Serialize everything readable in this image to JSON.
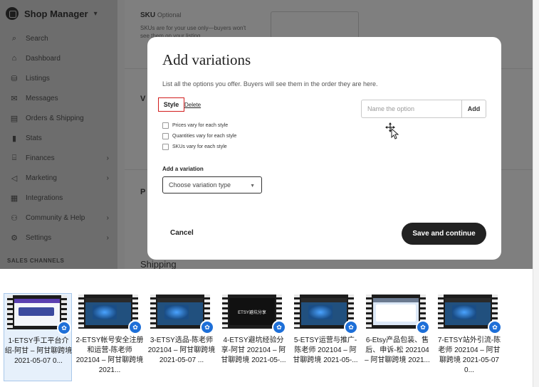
{
  "shop_manager": {
    "brand": "Shop Manager",
    "nav": [
      {
        "label": "Search",
        "icon": "search-icon"
      },
      {
        "label": "Dashboard",
        "icon": "home-icon"
      },
      {
        "label": "Listings",
        "icon": "listings-icon"
      },
      {
        "label": "Messages",
        "icon": "mail-icon"
      },
      {
        "label": "Orders & Shipping",
        "icon": "clipboard-icon"
      },
      {
        "label": "Stats",
        "icon": "bar-chart-icon"
      },
      {
        "label": "Finances",
        "icon": "bank-icon"
      },
      {
        "label": "Marketing",
        "icon": "megaphone-icon"
      },
      {
        "label": "Integrations",
        "icon": "grid-icon"
      },
      {
        "label": "Community & Help",
        "icon": "people-icon"
      },
      {
        "label": "Settings",
        "icon": "gear-icon"
      }
    ],
    "sales_channels": "SALES CHANNELS"
  },
  "background": {
    "sku_title": "SKU",
    "sku_optional": "Optional",
    "sku_desc": "SKUs are for your use only—buyers won't see them on your listing.",
    "shipping": "Shipping"
  },
  "modal": {
    "title": "Add variations",
    "subtitle": "List all the options you offer. Buyers will see them in the order they are here.",
    "style_tag": "Style",
    "delete_link": "Delete",
    "checkboxes": [
      "Prices vary for each style",
      "Quantities vary for each style",
      "SKUs vary for each style"
    ],
    "option_placeholder": "Name the option",
    "add_label": "Add",
    "add_variation_label": "Add a variation",
    "variation_select": "Choose variation type",
    "cancel_label": "Cancel",
    "save_label": "Save and continue"
  },
  "gallery": [
    {
      "caption": "1-ETSY手工平台介绍-阿甘 – 阿甘聊跨境 2021-05-07 0...",
      "style": "white"
    },
    {
      "caption": "2-ETSY帐号安全注册和运营-陈老师 202104 – 阿甘聊跨境 2021...",
      "style": "blue"
    },
    {
      "caption": "3-ETSY选品-陈老师 202104 – 阿甘聊跨境 2021-05-07 ...",
      "style": "blue"
    },
    {
      "caption": "4-ETSY避坑经验分享-阿甘 202104 – 阿甘聊跨境 2021-05-...",
      "style": "dark",
      "thumb_text": "ETSY避坑分享"
    },
    {
      "caption": "5-ETSY运营与推广-陈老师 202104 – 阿甘聊跨境 2021-05-...",
      "style": "blue"
    },
    {
      "caption": "6-Etsy产品包装、售后、申诉-松 202104 – 阿甘聊跨境 2021...",
      "style": "lightblue"
    },
    {
      "caption": "7-ETSY站外引流-陈老师 202104 – 阿甘聊跨境 2021-05-07 0...",
      "style": "blue"
    }
  ],
  "gallery_badge_icon": "film-reel-icon"
}
